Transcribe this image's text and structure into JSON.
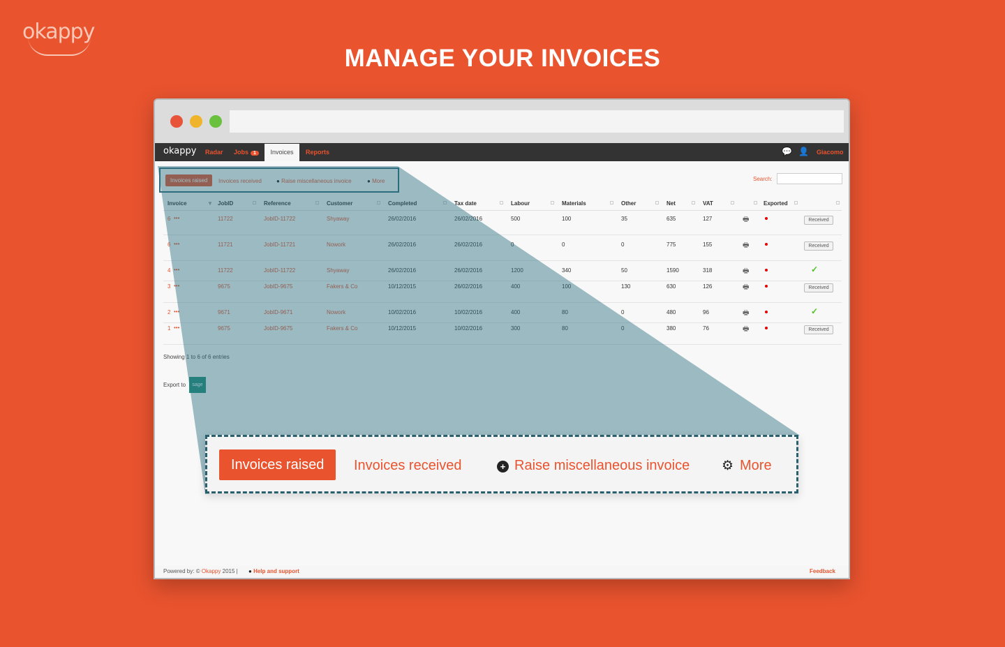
{
  "brand": "okappy",
  "headline": "MANAGE YOUR INVOICES",
  "nav": {
    "logo": "okappy",
    "radar": "Radar",
    "jobs": "Jobs",
    "jobs_badge": "1",
    "invoices": "Invoices",
    "reports": "Reports",
    "user": "Giacomo"
  },
  "tabs": {
    "raised": "Invoices raised",
    "received": "Invoices received",
    "raise_misc": "Raise miscellaneous invoice",
    "more": "More"
  },
  "search": {
    "label": "Search:",
    "value": ""
  },
  "table": {
    "headers": [
      "Invoice",
      "JobID",
      "Reference",
      "Customer",
      "Completed",
      "Tax date",
      "Labour",
      "Materials",
      "Other",
      "Net",
      "VAT",
      "Exported"
    ],
    "rows": [
      {
        "invoice": "6",
        "jobid": "11722",
        "reference": "JobID-11722",
        "customer": "Shyaway",
        "completed": "26/02/2016",
        "taxdate": "26/02/2016",
        "labour": "500",
        "materials": "100",
        "other": "35",
        "net": "635",
        "vat": "127",
        "exported": "Received"
      },
      {
        "invoice": "6",
        "jobid": "11721",
        "reference": "JobID-11721",
        "customer": "Nowork",
        "completed": "26/02/2016",
        "taxdate": "26/02/2016",
        "labour": "0",
        "materials": "0",
        "other": "0",
        "net": "775",
        "vat": "155",
        "exported": "Received"
      },
      {
        "invoice": "4",
        "jobid": "11722",
        "reference": "JobID-11722",
        "customer": "Shyaway",
        "completed": "26/02/2016",
        "taxdate": "26/02/2016",
        "labour": "1200",
        "materials": "340",
        "other": "50",
        "net": "1590",
        "vat": "318",
        "exported": "✓"
      },
      {
        "invoice": "3",
        "jobid": "9675",
        "reference": "JobID-9675",
        "customer": "Fakers & Co",
        "completed": "10/12/2015",
        "taxdate": "26/02/2016",
        "labour": "400",
        "materials": "100",
        "other": "130",
        "net": "630",
        "vat": "126",
        "exported": "Received"
      },
      {
        "invoice": "2",
        "jobid": "9671",
        "reference": "JobID-9671",
        "customer": "Nowork",
        "completed": "10/02/2016",
        "taxdate": "10/02/2016",
        "labour": "400",
        "materials": "80",
        "other": "0",
        "net": "480",
        "vat": "96",
        "exported": "✓"
      },
      {
        "invoice": "1",
        "jobid": "9675",
        "reference": "JobID-9675",
        "customer": "Fakers & Co",
        "completed": "10/12/2015",
        "taxdate": "10/02/2016",
        "labour": "300",
        "materials": "80",
        "other": "0",
        "net": "380",
        "vat": "76",
        "exported": "Received"
      }
    ]
  },
  "showing": "Showing 1 to 6 of 6 entries",
  "export": {
    "label": "Export to",
    "button": "sage"
  },
  "footer": {
    "powered": "Powered by: © ",
    "company": "Okappy",
    "year": " 2015  |",
    "help": "Help and support",
    "feedback": "Feedback"
  },
  "colors": {
    "accent": "#e9532e",
    "overlay": "#2a5f6e",
    "navbar": "#333333"
  }
}
